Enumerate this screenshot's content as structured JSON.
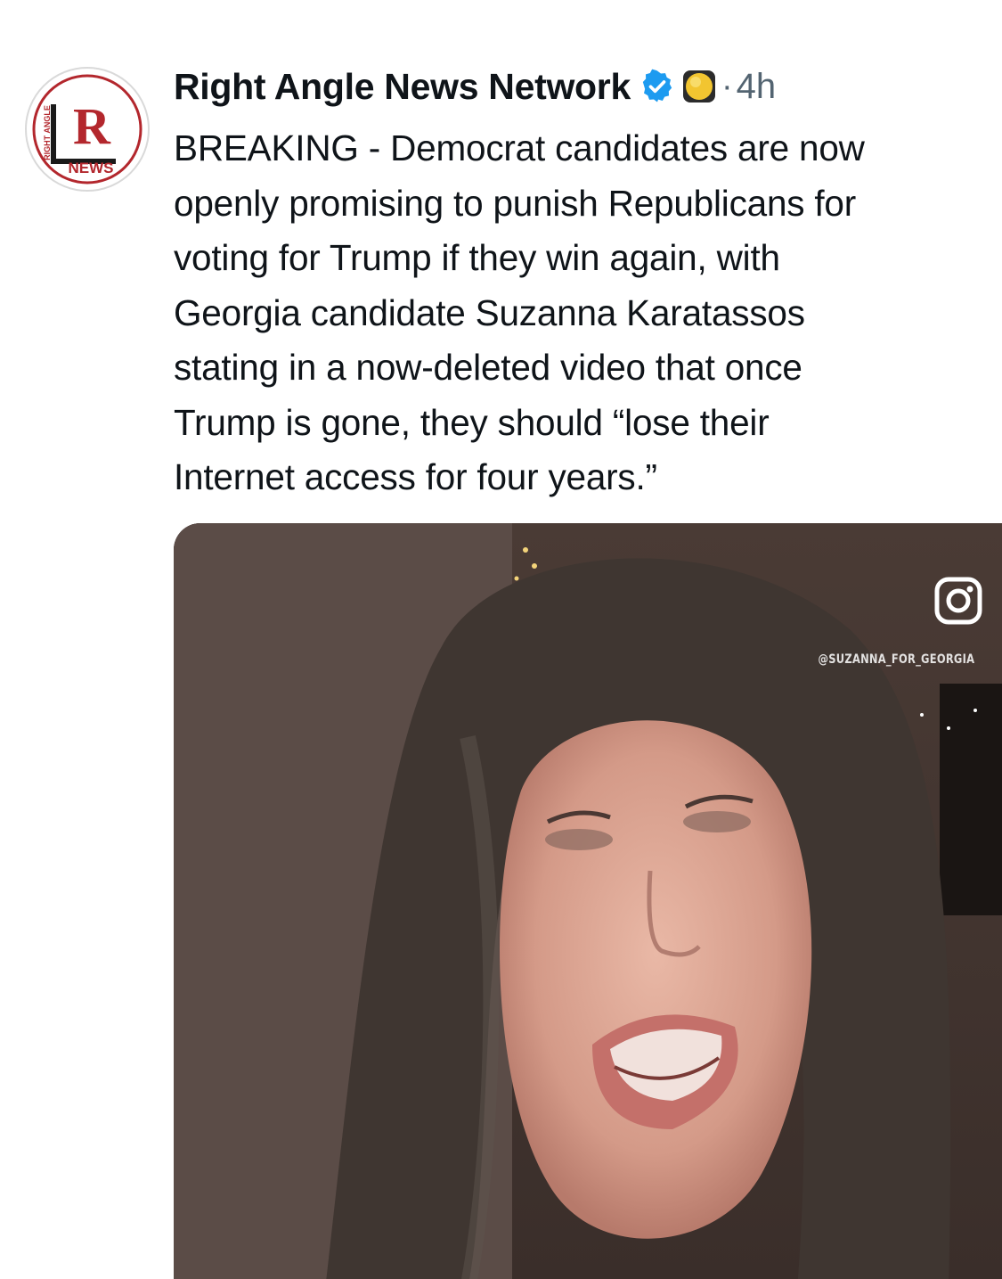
{
  "author": {
    "display_name": "Right Angle News Network",
    "avatar_icon": "right-angle-news-logo",
    "avatar_text_top": "RIGHT ANGLE",
    "avatar_letter": "R",
    "avatar_text_bottom": "NEWS",
    "verified_icon": "verified-badge-icon",
    "emoji_icon": "yellow-circle-emoji-icon"
  },
  "tweet": {
    "separator": "·",
    "timestamp": "4h",
    "text": "BREAKING - Democrat candidates are now\nopenly promising to punish Republicans for\nvoting for Trump if they win again, with\nGeorgia candidate Suzanna Karatassos\nstating in a now-deleted video that once\nTrump is gone, they should “lose their\nInternet access for four years.”"
  },
  "media": {
    "overlay_icon": "instagram-icon",
    "overlay_handle": "@SUZANNA_FOR_GEORGIA"
  },
  "colors": {
    "text_primary": "#0f1419",
    "text_secondary": "#536471",
    "verified_blue": "#1d9bf0",
    "brand_red": "#b3272d"
  }
}
